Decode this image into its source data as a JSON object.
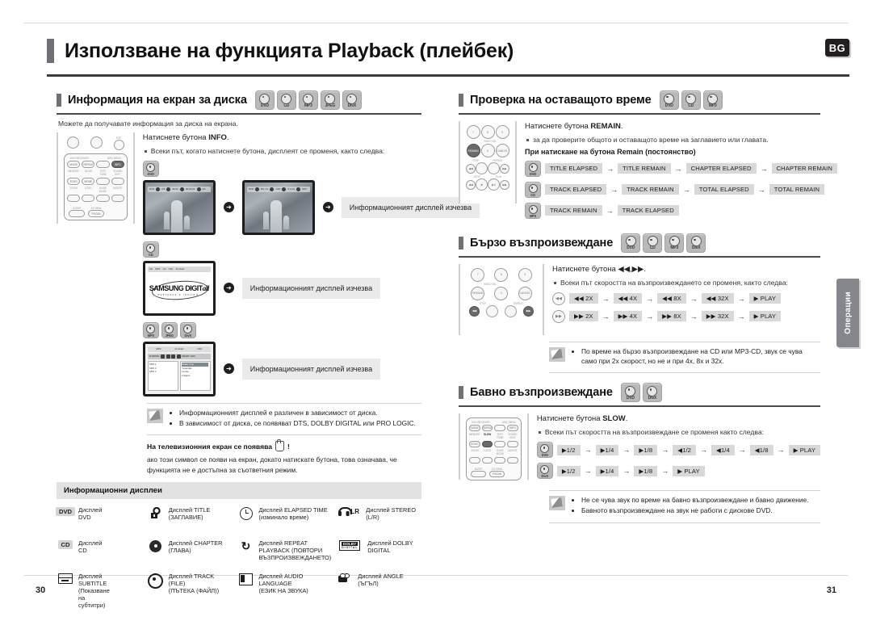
{
  "lang_badge": "BG",
  "chapter_title": "Използване на функцията Playback (плейбек)",
  "side_tab": "Операции",
  "page_left": "30",
  "page_right": "31",
  "disc_labels": {
    "dvd": "DVD",
    "cd": "CD",
    "mp3": "MP3",
    "jpeg": "JPEG",
    "divx": "DivX"
  },
  "left": {
    "section1": {
      "title": "Информация на екран за диска",
      "discs": [
        "DVD",
        "CD",
        "MP3",
        "JPEG",
        "DivX"
      ],
      "subtitle": "Можете да получавате информация за диска на екрана.",
      "instruction": "Натиснете бутона ",
      "instruction_bold": "INFO",
      "instruction_end": ".",
      "bullet": "Всеки път, когато натиснете бутона, дисплеят се променя, както следва:",
      "callout": "Информационният дисплей изчезва",
      "row1_disc": "DVD",
      "row2_disc": "CD",
      "row3_discs": [
        "MP3",
        "JPEG",
        "DivX"
      ],
      "tv1_osd": [
        "DVD",
        "2/3",
        "01/12",
        "00:03:21",
        "1/1"
      ],
      "tv2_osd": [
        "DVD",
        "BG 1/1",
        "OFF",
        "5.1CH",
        "OFF"
      ],
      "logo_osd": [
        "CD",
        "MP3",
        "1/4",
        "OFF",
        "44.1kHz"
      ],
      "logo_main": "SAMSUNG DIGIT",
      "logo_main_italic": "all",
      "logo_sub": "everyone's invited.",
      "browse_osd": [
        "MP3",
        "44.1kHz",
        "OFF"
      ],
      "browse_toolbar_left": "SORTING",
      "browse_toolbar_right": "SMART NAVI",
      "browse_left_items": [
        "MP3 1",
        "MP3 2",
        "MP3 3"
      ],
      "browse_right_items": [
        "Shake It Up",
        "Yesterday",
        "La Isla",
        "Imagine"
      ],
      "notes": [
        "Информационният дисплей е различен в зависимост от диска.",
        "В зависимост от диска, се появяват DTS, DOLBY DIGITAL или PRO LOGIC."
      ],
      "tv_symbol_heading": "На телевизионния екран се появява",
      "tv_symbol_suffix": "!",
      "tv_symbol_body": "ако този символ се появи на екран, докато натискате бутона, това означава, че функцията не е достъпна за съответния режим."
    },
    "table": {
      "title": "Информационни дисплеи",
      "cells": [
        {
          "icon": "dvd-tag",
          "tag": "DVD",
          "text": "Дисплей\nDVD"
        },
        {
          "icon": "title-icon",
          "tag": "",
          "text": "Дисплей TITLE\n(ЗАГЛАВИЕ)"
        },
        {
          "icon": "clock-icon",
          "tag": "",
          "text": "Дисплей ELAPSED TIME\n(изминало време)"
        },
        {
          "icon": "headphone-icon",
          "tag": "LR",
          "text": "Дисплей STEREO\n(L/R)"
        },
        {
          "icon": "cd-tag",
          "tag": "CD",
          "text": "Дисплей\nCD"
        },
        {
          "icon": "chapter-icon",
          "tag": "",
          "text": "Дисплей CHAPTER\n(ГЛАВА)"
        },
        {
          "icon": "repeat-icon",
          "tag": "",
          "text": "Дисплей REPEAT\nPLAYBACK (ПОВТОРИ\nВЪЗПРОИЗВЕЖДАНЕТО)"
        },
        {
          "icon": "dolby-icon",
          "tag": "",
          "text": "Дисплей DOLBY\nDIGITAL"
        },
        {
          "icon": "subtitle-icon",
          "tag": "",
          "text": "Дисплей\nSUBTITLE\n(Показване\nна\nсубтитри)"
        },
        {
          "icon": "track-icon",
          "tag": "",
          "text": "Дисплей TRACK (FILE)\n(ПЪТЕКА (ФАЙЛ))"
        },
        {
          "icon": "audio-language-icon",
          "tag": "",
          "text": "Дисплей AUDIO LANGUAGE\n(ЕЗИК НА ЗВУКА)"
        },
        {
          "icon": "angle-icon",
          "tag": "",
          "text": "Дисплей ANGLE\n(ЪГЪЛ)"
        }
      ]
    }
  },
  "right": {
    "section_remain": {
      "title": "Проверка на оставащото време",
      "discs": [
        "DVD",
        "CD",
        "MP3"
      ],
      "instruction": "Натиснете бутона ",
      "instruction_bold": "REMAIN",
      "instruction_end": ".",
      "bullet": "за да проверите общото и оставащото време на заглавието или главата.",
      "subheading": "При натискане на бутона Remain (постоянство)",
      "sequences": [
        {
          "disc": "DVD",
          "steps": [
            "TITLE ELAPSED",
            "TITLE REMAIN",
            "CHAPTER ELAPSED",
            "CHAPTER REMAIN"
          ]
        },
        {
          "disc": "CD",
          "steps": [
            "TRACK ELAPSED",
            "TRACK REMAIN",
            "TOTAL ELAPSED",
            "TOTAL REMAIN"
          ]
        },
        {
          "disc": "MP3",
          "steps": [
            "TRACK REMAIN",
            "TRACK ELAPSED"
          ]
        }
      ]
    },
    "section_fast": {
      "title": "Бързо възпроизвеждане",
      "discs": [
        "DVD",
        "CD",
        "MP3",
        "DivX"
      ],
      "instruction": "Натиснете бутона ◀◀,▶▶.",
      "bullet": "Всеки път скоростта на възпроизвеждането се променя, както следва:",
      "sequences": [
        {
          "button": "rewind",
          "steps": [
            "◀◀ 2X",
            "◀◀ 4X",
            "◀◀ 8X",
            "◀◀ 32X",
            "▶ PLAY"
          ]
        },
        {
          "button": "forward",
          "steps": [
            "▶▶ 2X",
            "▶▶ 4X",
            "▶▶ 8X",
            "▶▶ 32X",
            "▶ PLAY"
          ]
        }
      ],
      "notes": [
        "По време на бързо възпроизвеждане на CD или MP3-CD, звук се чува само при 2x скорост, но не и при 4x, 8x и 32x."
      ]
    },
    "section_slow": {
      "title": "Бавно възпроизвеждане",
      "discs": [
        "DVD",
        "DivX"
      ],
      "instruction": "Натиснете бутона ",
      "instruction_bold": "SLOW",
      "instruction_end": ".",
      "bullet": "Всеки път скоростта на възпроизвеждане се променя както следва:",
      "sequences": [
        {
          "disc": "DVD",
          "steps": [
            "▶1/2",
            "▶1/4",
            "▶1/8",
            "◀1/2",
            "◀1/4",
            "◀1/8",
            "▶ PLAY"
          ]
        },
        {
          "disc": "DivX",
          "steps": [
            "▶1/2",
            "▶1/4",
            "▶1/8",
            "▶ PLAY"
          ]
        }
      ],
      "notes": [
        "Не се чува звук по време на бавно възпроизвеждане и бавно движение.",
        "Бавното възпроизвеждане на звук не работи с дискове DVD."
      ]
    }
  },
  "remote_keys": {
    "top_remote": [
      "MODE",
      "REPEAT",
      "",
      "INFO",
      "TEST TONE",
      "SOUND EDIT",
      "ECHO",
      "MOVIE",
      "ZOOM",
      "LOGO",
      "SLIDE MODE",
      "DIGEST",
      "SLEEP",
      "EZ VIEW",
      "P.SCAN",
      "SLOW"
    ],
    "num_remote": [
      "7",
      "8",
      "9",
      "REMAIN",
      "0",
      "CANCEL",
      "STEP",
      "REPEAT",
      "STOP",
      "PLAY"
    ],
    "labels": {
      "video_sel": "VIDEO SEL",
      "exit": "EXIT",
      "dvd_receiver": "DVD RECEIVER",
      "disc_menu": "DISC MENU"
    }
  }
}
